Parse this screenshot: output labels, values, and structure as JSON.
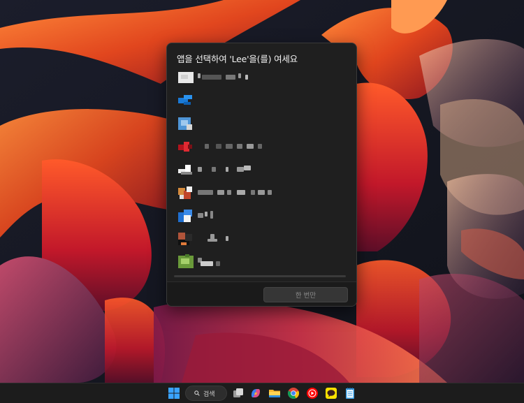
{
  "dialog": {
    "title": "앱을 선택하여 'Lee'을(를) 여세요",
    "apps": [
      {
        "icon": "app-icon-white"
      },
      {
        "icon": "app-icon-blue"
      },
      {
        "icon": "app-icon-lightblue"
      },
      {
        "icon": "app-icon-red"
      },
      {
        "icon": "app-icon-mono"
      },
      {
        "icon": "app-icon-orange"
      },
      {
        "icon": "app-icon-blue-white"
      },
      {
        "icon": "app-icon-brown-black"
      },
      {
        "icon": "app-icon-green"
      }
    ],
    "once_button_label": "한 번만"
  },
  "taskbar": {
    "search_label": "검색",
    "icons": [
      "windows-start-icon",
      "search-icon",
      "task-view-icon",
      "copilot-icon",
      "file-explorer-icon",
      "chrome-icon",
      "youtube-music-icon",
      "kakaotalk-icon",
      "notepad-icon"
    ]
  },
  "colors": {
    "dialog_bg": "#1f1f1f",
    "taskbar_bg": "#1c1c1c",
    "wallpaper_accent": "#e0442a"
  }
}
